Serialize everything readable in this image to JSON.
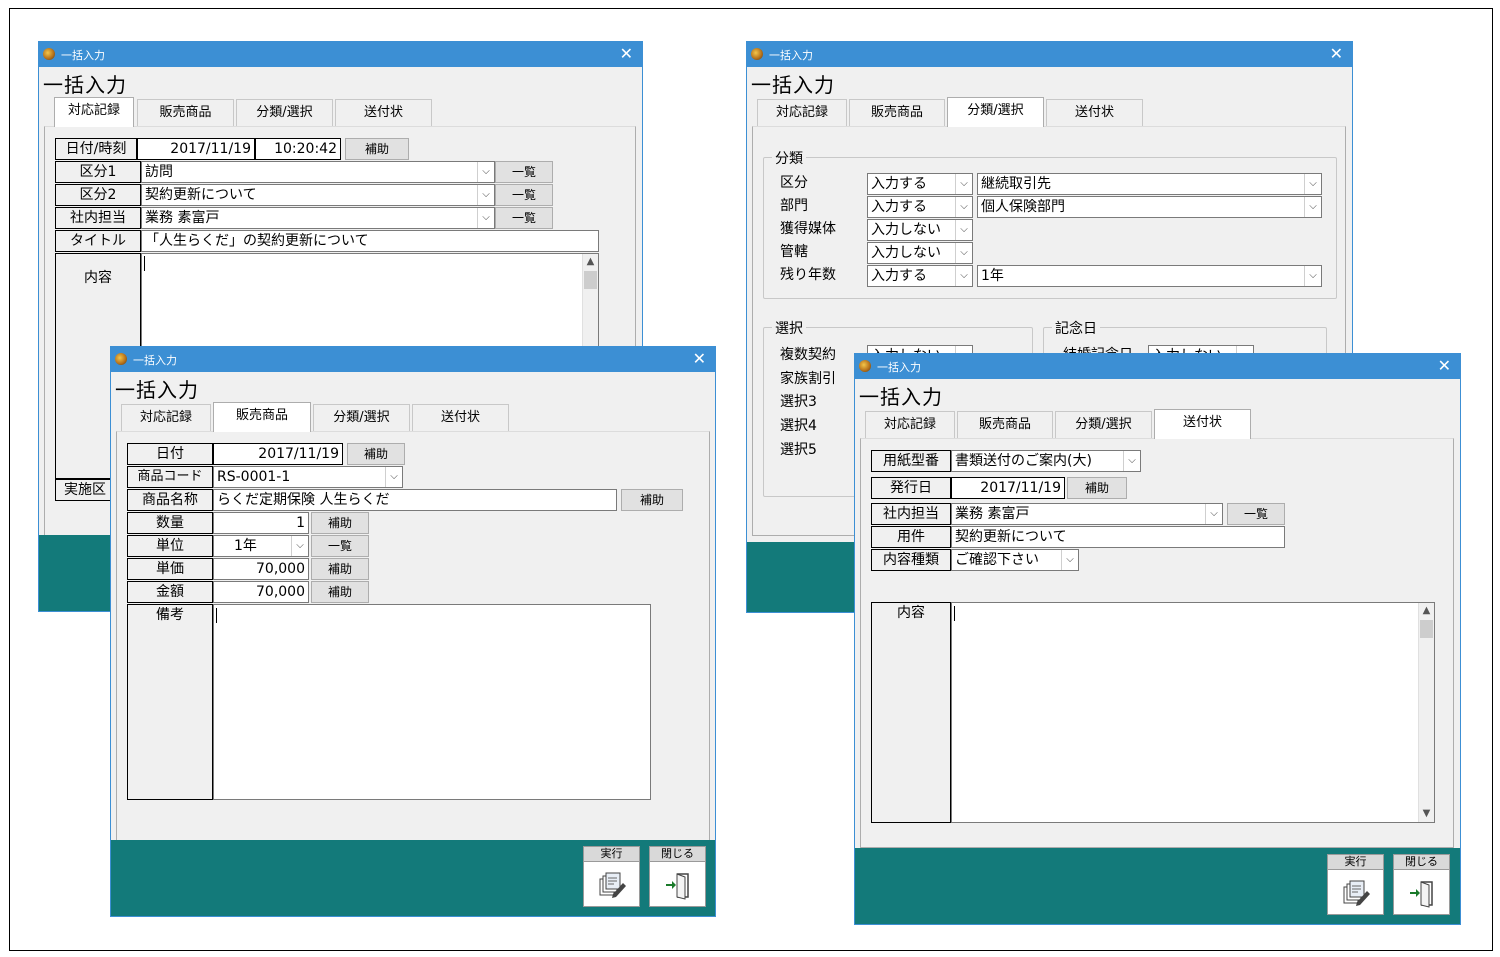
{
  "window_title": "一括入力",
  "header_title": "一括入力",
  "tabs": [
    "対応記録",
    "販売商品",
    "分類/選択",
    "送付状"
  ],
  "buttons": {
    "assist": "補助",
    "list": "一覧",
    "execute": "実行",
    "close": "閉じる"
  },
  "record_tab": {
    "datetime_label": "日付/時刻",
    "date": "2017/11/19",
    "time": "10:20:42",
    "cat1_label": "区分1",
    "cat1_value": "訪問",
    "cat2_label": "区分2",
    "cat2_value": "契約更新について",
    "staff_label": "社内担当",
    "staff_value": "業務 素富戸",
    "title_label": "タイトル",
    "title_value": "「人生らくだ」の契約更新について",
    "content_label": "内容",
    "impl_label": "実施区"
  },
  "product_tab": {
    "date_label": "日付",
    "date": "2017/11/19",
    "code_label": "商品コード",
    "code_value": "RS-0001-1",
    "name_label": "商品名称",
    "name_value": "らくだ定期保険 人生らくだ",
    "qty_label": "数量",
    "qty_value": "1",
    "unit_label": "単位",
    "unit_value": "1年",
    "price_label": "単価",
    "price_value": "70,000",
    "amount_label": "金額",
    "amount_value": "70,000",
    "note_label": "備考"
  },
  "category_tab": {
    "group_label": "分類",
    "rows": [
      {
        "label": "区分",
        "mode": "入力する",
        "value": "継続取引先"
      },
      {
        "label": "部門",
        "mode": "入力する",
        "value": "個人保険部門"
      },
      {
        "label": "獲得媒体",
        "mode": "入力しない",
        "value": ""
      },
      {
        "label": "管轄",
        "mode": "入力しない",
        "value": ""
      },
      {
        "label": "残り年数",
        "mode": "入力する",
        "value": "1年"
      }
    ],
    "select_group_label": "選択",
    "select_rows": [
      "複数契約",
      "家族割引",
      "選択3",
      "選択4",
      "選択5"
    ],
    "select_first_mode": "入力しない",
    "anniv_group_label": "記念日",
    "anniv_row_label": "結婚記念日",
    "anniv_row_mode": "入力しない"
  },
  "letter_tab": {
    "paper_label": "用紙型番",
    "paper_value": "書類送付のご案内(大)",
    "issue_label": "発行日",
    "issue_date": "2017/11/19",
    "staff_label": "社内担当",
    "staff_value": "業務 素富戸",
    "subject_label": "用件",
    "subject_value": "契約更新について",
    "ctype_label": "内容種類",
    "ctype_value": "ご確認下さい",
    "content_label": "内容"
  }
}
